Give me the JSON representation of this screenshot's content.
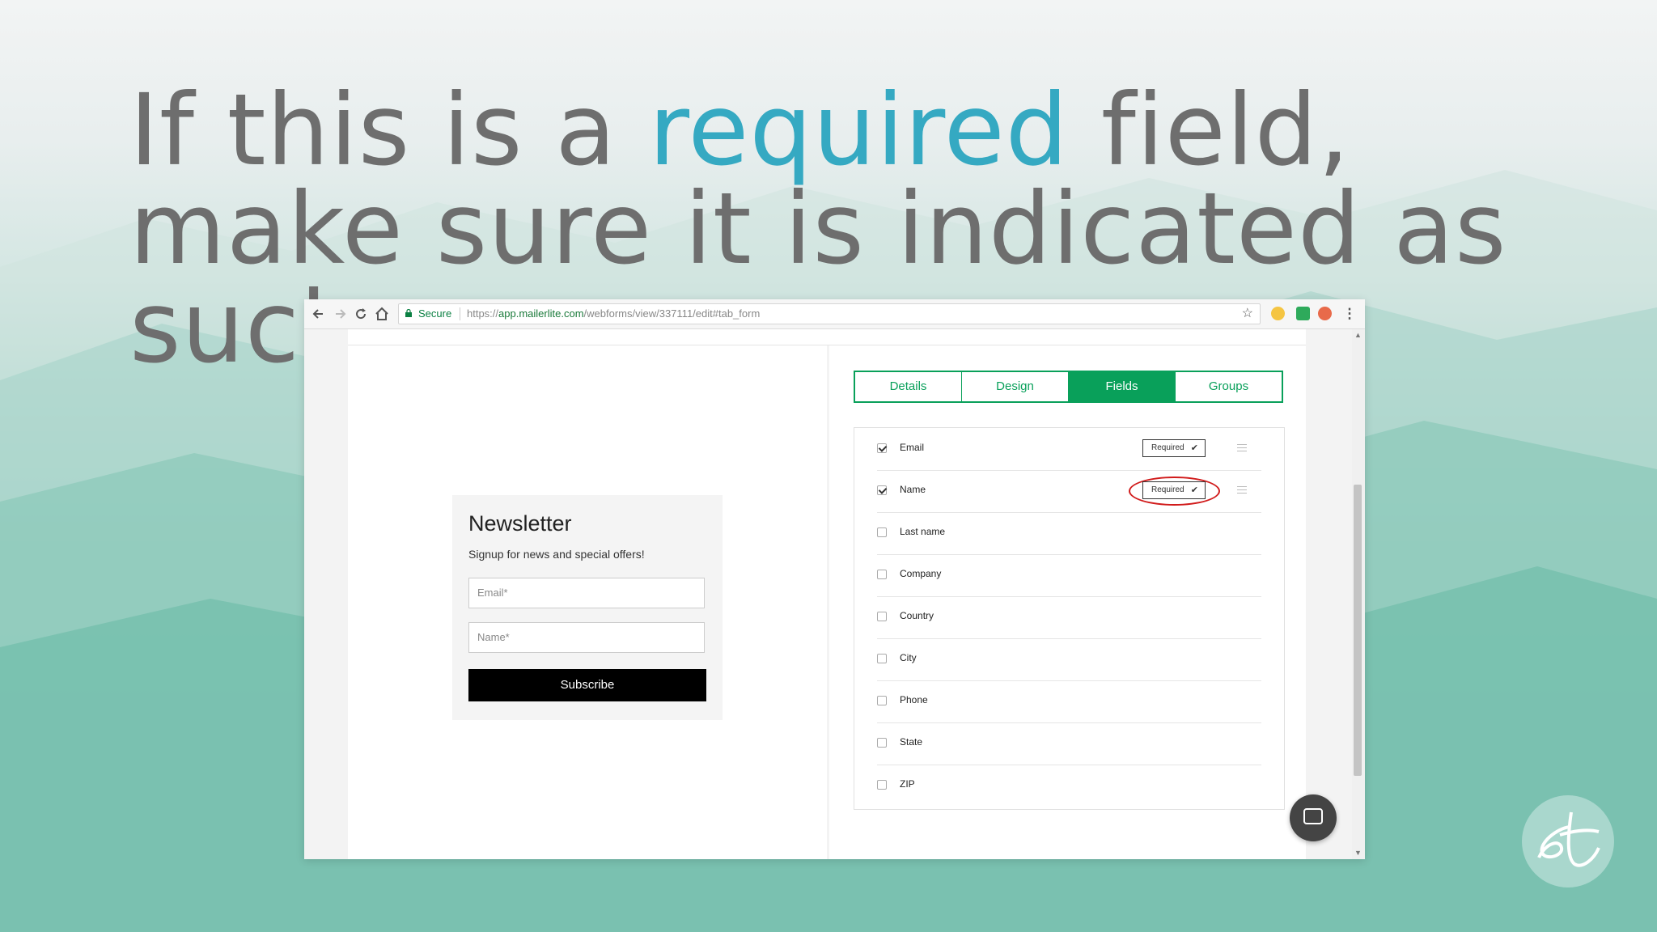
{
  "slide": {
    "headline_part1": "If this is a ",
    "headline_accent": "required",
    "headline_part2": " field, make sure it is indicated as such.",
    "accent_color": "#35a9c2",
    "logo_text": "et"
  },
  "browser": {
    "secure_label": "Secure",
    "url_scheme": "https://",
    "url_host": "app.mailerlite.com",
    "url_path": "/webforms/view/337111/edit#tab_form",
    "icons": [
      "back-arrow-icon",
      "forward-arrow-icon",
      "reload-icon",
      "home-icon",
      "lock-icon",
      "star-icon"
    ]
  },
  "newsletter_form": {
    "title": "Newsletter",
    "subtitle": "Signup for news and special offers!",
    "email_placeholder": "Email*",
    "name_placeholder": "Name*",
    "subscribe_label": "Subscribe"
  },
  "tabs": [
    {
      "label": "Details",
      "active": false
    },
    {
      "label": "Design",
      "active": false
    },
    {
      "label": "Fields",
      "active": true
    },
    {
      "label": "Groups",
      "active": false
    }
  ],
  "fields": [
    {
      "label": "Email",
      "checked": true,
      "required_label": "Required"
    },
    {
      "label": "Name",
      "checked": true,
      "required_label": "Required"
    },
    {
      "label": "Last name",
      "checked": false
    },
    {
      "label": "Company",
      "checked": false
    },
    {
      "label": "Country",
      "checked": false
    },
    {
      "label": "City",
      "checked": false
    },
    {
      "label": "Phone",
      "checked": false
    },
    {
      "label": "State",
      "checked": false
    },
    {
      "label": "ZIP",
      "checked": false
    }
  ],
  "brand_color": "#09a05a"
}
